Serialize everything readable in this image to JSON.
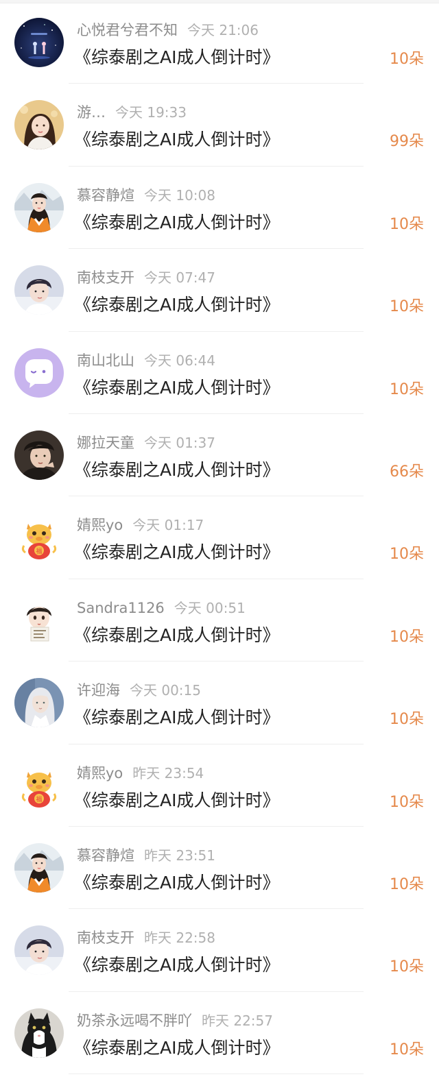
{
  "entries": [
    {
      "name": "心悦君兮君不知",
      "time": "今天 21:06",
      "gift": "《综泰剧之AI成人倒计时》",
      "amount": "10朵",
      "avatar": "avatar-night-sky"
    },
    {
      "name": "游…",
      "time": "今天 19:33",
      "gift": "《综泰剧之AI成人倒计时》",
      "amount": "99朵",
      "avatar": "avatar-girl-portrait"
    },
    {
      "name": "慕容静煊",
      "time": "今天 10:08",
      "gift": "《综泰剧之AI成人倒计时》",
      "amount": "10朵",
      "avatar": "avatar-girl-winter"
    },
    {
      "name": "南枝支开",
      "time": "今天 07:47",
      "gift": "《综泰剧之AI成人倒计时》",
      "amount": "10朵",
      "avatar": "avatar-boy-portrait"
    },
    {
      "name": "南山北山",
      "time": "今天 06:44",
      "gift": "《综泰剧之AI成人倒计时》",
      "amount": "10朵",
      "avatar": "avatar-default-chat"
    },
    {
      "name": "娜拉天童",
      "time": "今天 01:37",
      "gift": "《综泰剧之AI成人倒计时》",
      "amount": "66朵",
      "avatar": "avatar-man-dark"
    },
    {
      "name": "婧熙yo",
      "time": "今天 01:17",
      "gift": "《综泰剧之AI成人倒计时》",
      "amount": "10朵",
      "avatar": "avatar-cartoon-dragon"
    },
    {
      "name": "Sandra1126",
      "time": "今天 00:51",
      "gift": "《综泰剧之AI成人倒计时》",
      "amount": "10朵",
      "avatar": "avatar-cartoon-boy"
    },
    {
      "name": "许迎海",
      "time": "今天 00:15",
      "gift": "《综泰剧之AI成人倒计时》",
      "amount": "10朵",
      "avatar": "avatar-silver-hair"
    },
    {
      "name": "婧熙yo",
      "time": "昨天 23:54",
      "gift": "《综泰剧之AI成人倒计时》",
      "amount": "10朵",
      "avatar": "avatar-cartoon-dragon"
    },
    {
      "name": "慕容静煊",
      "time": "昨天 23:51",
      "gift": "《综泰剧之AI成人倒计时》",
      "amount": "10朵",
      "avatar": "avatar-girl-winter"
    },
    {
      "name": "南枝支开",
      "time": "昨天 22:58",
      "gift": "《综泰剧之AI成人倒计时》",
      "amount": "10朵",
      "avatar": "avatar-boy-portrait"
    },
    {
      "name": "奶茶永远喝不胖吖",
      "time": "昨天 22:57",
      "gift": "《综泰剧之AI成人倒计时》",
      "amount": "10朵",
      "avatar": "avatar-black-white-cat"
    }
  ],
  "colors": {
    "name": "#8c8c8c",
    "time": "#b0b0b0",
    "gift": "#222222",
    "amount": "#e5894b",
    "divider": "#eeeeee"
  }
}
